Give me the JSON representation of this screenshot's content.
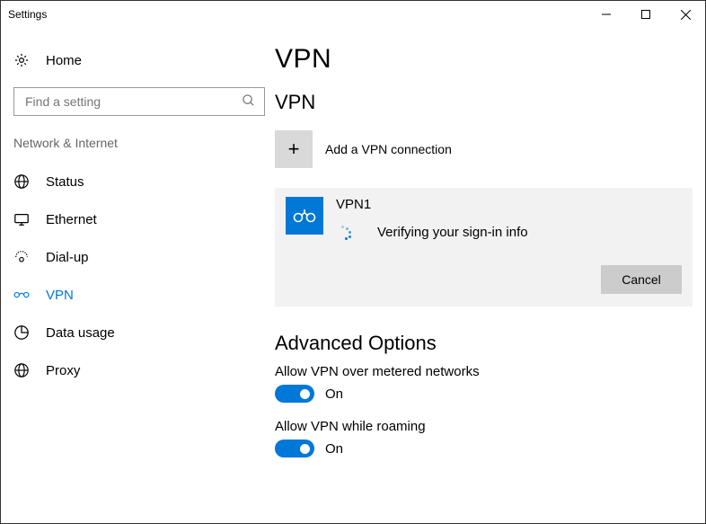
{
  "window": {
    "title": "Settings"
  },
  "sidebar": {
    "home": "Home",
    "search_placeholder": "Find a setting",
    "section": "Network & Internet",
    "items": [
      {
        "label": "Status"
      },
      {
        "label": "Ethernet"
      },
      {
        "label": "Dial-up"
      },
      {
        "label": "VPN"
      },
      {
        "label": "Data usage"
      },
      {
        "label": "Proxy"
      }
    ]
  },
  "main": {
    "title": "VPN",
    "section": "VPN",
    "add_label": "Add a VPN connection",
    "connection": {
      "name": "VPN1",
      "status": "Verifying your sign-in info",
      "cancel": "Cancel"
    },
    "advanced": {
      "title": "Advanced Options",
      "opt1_label": "Allow VPN over metered networks",
      "opt1_state": "On",
      "opt2_label": "Allow VPN while roaming",
      "opt2_state": "On"
    }
  }
}
